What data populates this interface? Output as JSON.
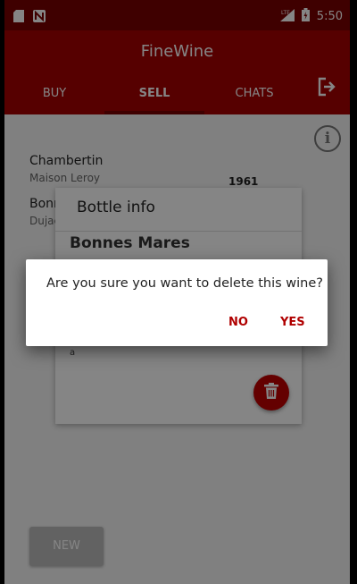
{
  "status_bar": {
    "time": "5:50",
    "network": "LTE"
  },
  "app": {
    "title": "FineWine",
    "brand_color": "#a50000",
    "accent_color": "#c00000"
  },
  "tabs": [
    {
      "label": "BUY",
      "active": false
    },
    {
      "label": "SELL",
      "active": true
    },
    {
      "label": "CHATS",
      "active": false
    }
  ],
  "wine_list": [
    {
      "name": "Chambertin",
      "maker": "Maison Leroy",
      "year": "1961"
    },
    {
      "name": "Bonnes Mares",
      "maker": "Dujac"
    }
  ],
  "bottle_dialog": {
    "title": "Bottle info",
    "wine_name": "Bonnes Mares",
    "description": "a"
  },
  "new_button_label": "NEW",
  "confirm_dialog": {
    "message": "Are you sure you want to delete this wine?",
    "no_label": "NO",
    "yes_label": "YES"
  },
  "icons": [
    "sd-card-icon",
    "n-logo-icon",
    "signal-icon",
    "battery-icon",
    "exit-icon",
    "info-icon",
    "trash-icon"
  ]
}
